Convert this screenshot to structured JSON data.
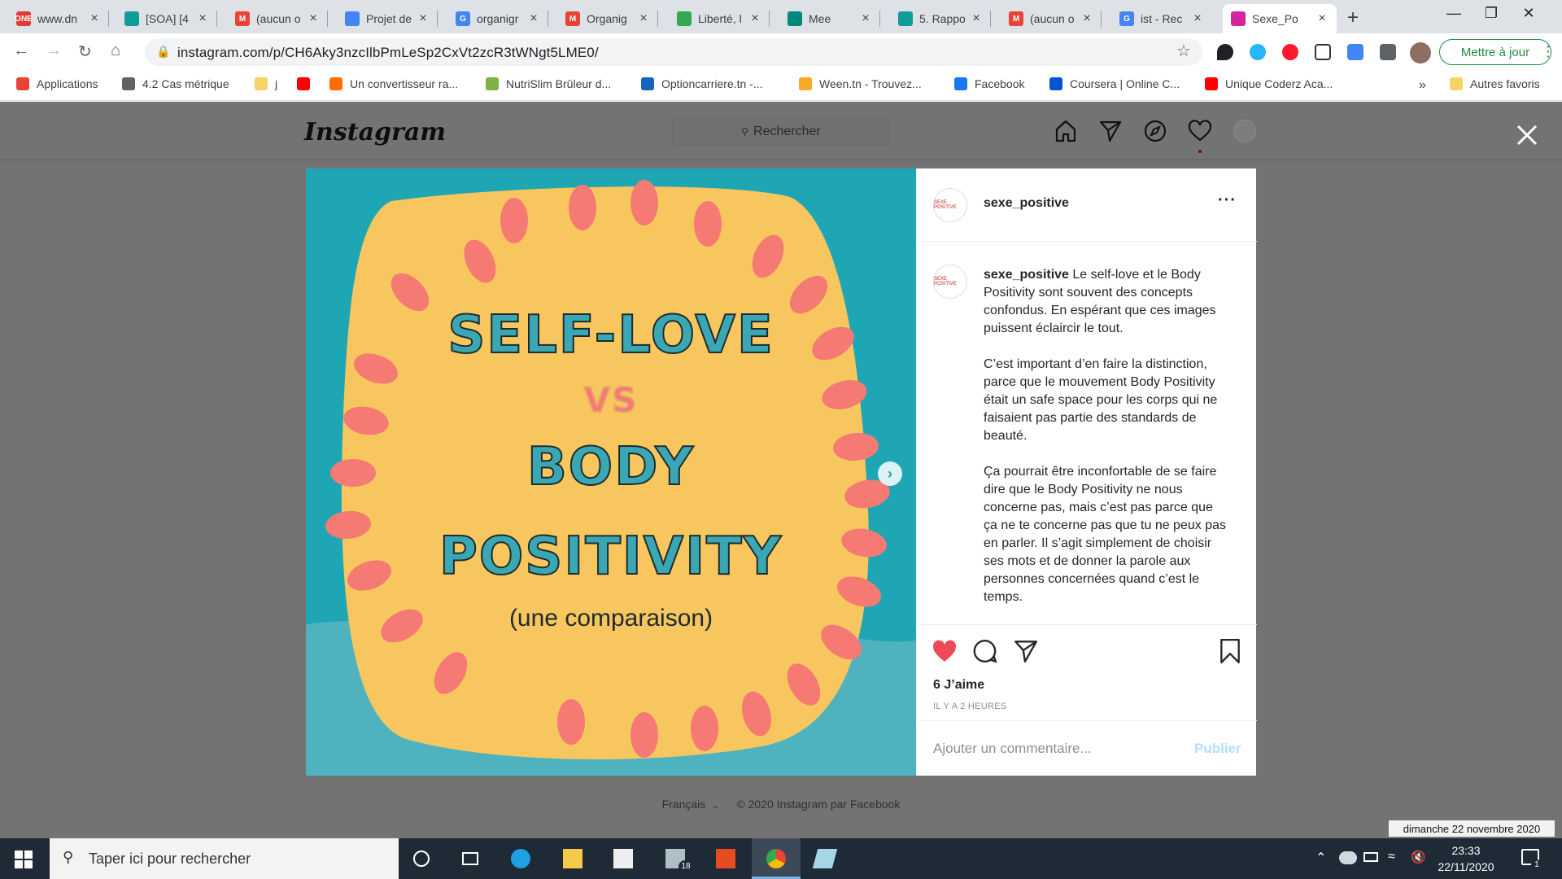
{
  "browser": {
    "tabs": [
      {
        "label": "www.dn",
        "fav": "ONE",
        "color": "#e53935"
      },
      {
        "label": "[SOA] [4",
        "fav": "",
        "color": "#0f9d9a"
      },
      {
        "label": "(aucun o",
        "fav": "M",
        "color": "#ea4335"
      },
      {
        "label": "Projet de",
        "fav": "",
        "color": "#4285f4"
      },
      {
        "label": "organigr",
        "fav": "G",
        "color": "#4285f4"
      },
      {
        "label": "Organig",
        "fav": "M",
        "color": "#ea4335"
      },
      {
        "label": "Liberté, l",
        "fav": "",
        "color": "#34a853"
      },
      {
        "label": "Mee",
        "fav": "",
        "color": "#00897b"
      },
      {
        "label": "5. Rappo",
        "fav": "",
        "color": "#0f9d9a"
      },
      {
        "label": "(aucun o",
        "fav": "M",
        "color": "#ea4335"
      },
      {
        "label": "ist - Rec",
        "fav": "G",
        "color": "#4285f4"
      },
      {
        "label": "Sexe_Po",
        "fav": "",
        "color": "#d6249f"
      }
    ],
    "url": "instagram.com/p/CH6Aky3nzcIlbPmLeSp2CxVt2zcR3tWNgt5LME0/",
    "update_button": "Mettre à jour",
    "bookmarks": [
      {
        "label": "Applications",
        "color": "#ea4335"
      },
      {
        "label": "4.2 Cas métrique",
        "color": "#5f6368"
      },
      {
        "label": "j",
        "color": "#f6d365"
      },
      {
        "label": "",
        "color": "#ff0000"
      },
      {
        "label": "Un convertisseur ra...",
        "color": "#ff6d00"
      },
      {
        "label": "NutriSlim Brûleur d...",
        "color": "#7cb342"
      },
      {
        "label": "Optioncarriere.tn -...",
        "color": "#1565c0"
      },
      {
        "label": "Ween.tn - Trouvez...",
        "color": "#f9a825"
      },
      {
        "label": "Facebook",
        "color": "#1877f2"
      },
      {
        "label": "Coursera | Online C...",
        "color": "#0056d2"
      },
      {
        "label": "Unique Coderz Aca...",
        "color": "#ff0000"
      }
    ],
    "more_bookmarks": "»",
    "other_bookmarks": "Autres favoris"
  },
  "instagram": {
    "logo": "Instagram",
    "search_placeholder": "Rechercher",
    "username": "sexe_positive",
    "avatar_text": "SEXE POSITIVE",
    "post_image": {
      "line1": "SELF-LOVE",
      "line2": "VS",
      "line3": "BODY",
      "line4": "POSITIVITY",
      "line5": "(une comparaison)"
    },
    "caption": {
      "p1": "Le self-love et le Body Positivity sont souvent des concepts confondus. En espérant que ces images puissent éclaircir le tout.",
      "p2": "C’est important d’en faire la distinction, parce que le mouvement Body Positivity était un safe space pour les corps qui ne faisaient pas partie des standards de beauté.",
      "p3": "Ça pourrait être inconfortable de se faire dire que le Body Positivity ne nous concerne pas, mais c’est pas parce que ça ne te concerne pas que tu ne peux pas en parler. Il s’agit simplement de choisir ses mots et de donner la parole aux personnes concernées quand c’est le temps."
    },
    "likes": "6 J’aime",
    "time_ago": "IL Y A 2 HEURES",
    "comment_placeholder": "Ajouter un commentaire...",
    "publish": "Publier",
    "footer_lang": "Français",
    "footer_copy": "© 2020 Instagram par Facebook"
  },
  "taskbar": {
    "search_placeholder": "Taper ici pour rechercher",
    "time": "23:33",
    "date": "22/11/2020",
    "tooltip": "dimanche 22 novembre 2020",
    "mail_badge": "18",
    "notif_badge": "1"
  }
}
